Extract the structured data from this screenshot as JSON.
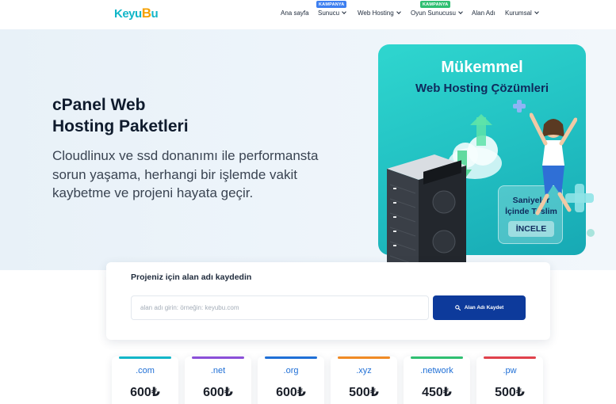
{
  "header": {
    "logo": {
      "part1": "Keyu",
      "part2": "B",
      "part3": "u"
    },
    "nav": [
      {
        "label": "Ana sayfa",
        "has_dropdown": false,
        "badge": null
      },
      {
        "label": "Sunucu",
        "has_dropdown": true,
        "badge": "KAMPANYA"
      },
      {
        "label": "Web Hosting",
        "has_dropdown": true,
        "badge": null
      },
      {
        "label": "Oyun Sunucusu",
        "has_dropdown": true,
        "badge": "KAMPANYA"
      },
      {
        "label": "Alan Adı",
        "has_dropdown": false,
        "badge": null
      },
      {
        "label": "Kurumsal",
        "has_dropdown": true,
        "badge": null
      }
    ],
    "badge_colors": {
      "sunucu": "#3d7ff0",
      "oyun": "#2fbf71"
    }
  },
  "hero": {
    "title_line1": "cPanel Web",
    "title_line2": "Hosting Paketleri",
    "desc_line1": "Cloudlinux ve ssd donanımı ile performansta",
    "desc_line2": "sorun yaşama, herhangi bir işlemde vakit",
    "desc_line3": "kaybetme ve projeni hayata geçir.",
    "promo": {
      "title1": "Mükemmel",
      "title2": "Web Hosting Çözümleri",
      "sub_line1": "Saniyeler",
      "sub_line2": "İçinde Teslim",
      "button": "İNCELE"
    }
  },
  "domain_search": {
    "title": "Projeniz için alan adı kaydedin",
    "placeholder": "alan adı girin: örneğin: keyubu.com",
    "button": "Alan Adı Kaydet"
  },
  "tlds": [
    {
      "name": ".com",
      "price": "600₺",
      "color": "#12b6c8"
    },
    {
      "name": ".net",
      "price": "600₺",
      "color": "#8a4fd8"
    },
    {
      "name": ".org",
      "price": "600₺",
      "color": "#1f6fd6"
    },
    {
      "name": ".xyz",
      "price": "500₺",
      "color": "#f08a24"
    },
    {
      "name": ".network",
      "price": "450₺",
      "color": "#2fbf71"
    },
    {
      "name": ".pw",
      "price": "500₺",
      "color": "#e0414b"
    }
  ],
  "colors": {
    "primary": "#0d3a9b",
    "accent": "#12b6c8",
    "promo": "#23c3c4"
  }
}
